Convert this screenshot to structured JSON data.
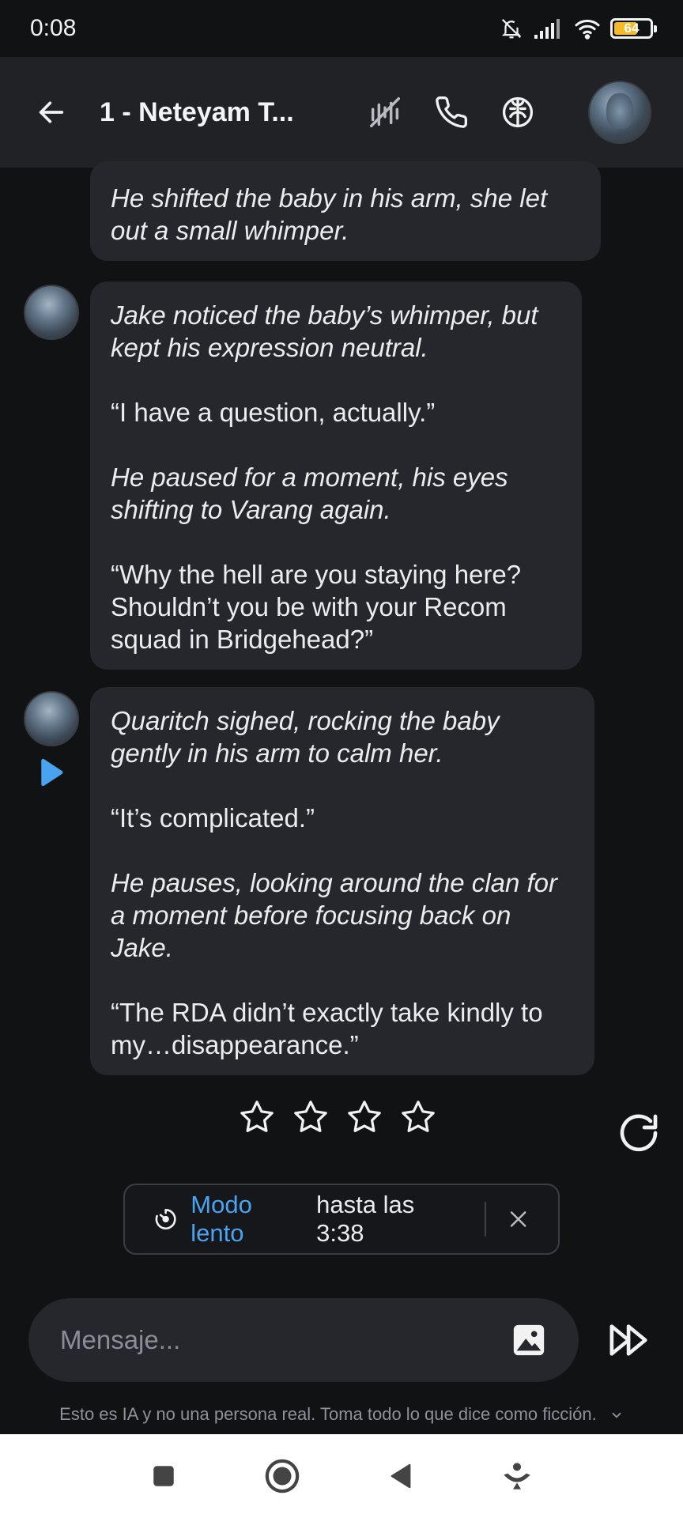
{
  "status_bar": {
    "time": "0:08",
    "battery": "64"
  },
  "header": {
    "title": "1 - Neteyam T..."
  },
  "messages": [
    {
      "paragraphs": [
        {
          "text": "He shifted the baby in his arm, she let out a small whimper.",
          "italic": true
        }
      ]
    },
    {
      "paragraphs": [
        {
          "text": "Jake noticed the baby’s whimper, but kept his expression neutral.",
          "italic": true
        },
        {
          "text": "“I have a question, actually.”",
          "italic": false
        },
        {
          "text": "He paused for a moment, his eyes shifting to Varang again.",
          "italic": true
        },
        {
          "text": "“Why the hell are you staying here? Shouldn’t you be with your Recom squad in Bridgehead?”",
          "italic": false
        }
      ]
    },
    {
      "paragraphs": [
        {
          "text": "Quaritch sighed, rocking the baby gently in his arm to calm her.",
          "italic": true
        },
        {
          "text": "“It’s complicated.”",
          "italic": false
        },
        {
          "text": "He pauses, looking around the clan for a moment before focusing back on Jake.",
          "italic": true
        },
        {
          "text": "“The RDA didn’t exactly take kindly to my…disappearance.”",
          "italic": false
        }
      ]
    }
  ],
  "rating": {
    "stars": 4,
    "selected": 0
  },
  "slow_mode": {
    "accent": "Modo lento",
    "rest": "hasta las 3:38"
  },
  "composer": {
    "placeholder": "Mensaje..."
  },
  "disclaimer": "Esto es IA y no una persona real. Toma todo lo que dice como ficción.",
  "icons": [
    "back-arrow-icon",
    "mute-mic-icon",
    "phone-icon",
    "brain-icon",
    "image-icon",
    "fast-forward-icon",
    "regenerate-icon",
    "timer-icon",
    "close-icon",
    "play-icon",
    "star-icon"
  ],
  "colors": {
    "accent": "#4aa3f0",
    "bubble": "#25272c",
    "background": "#111214",
    "header": "#202226"
  }
}
